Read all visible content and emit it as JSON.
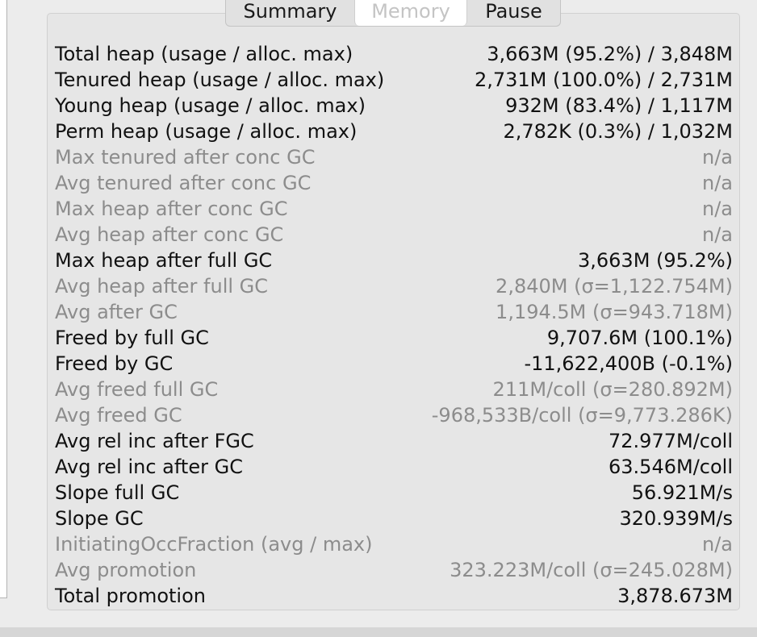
{
  "tabs": [
    {
      "label": "Summary"
    },
    {
      "label": "Memory"
    },
    {
      "label": "Pause"
    }
  ],
  "rows": [
    {
      "label": "Total heap (usage / alloc. max)",
      "value": "3,663M (95.2%) / 3,848M",
      "dim": false
    },
    {
      "label": "Tenured heap (usage / alloc. max)",
      "value": "2,731M (100.0%) / 2,731M",
      "dim": false
    },
    {
      "label": "Young heap (usage / alloc. max)",
      "value": "932M (83.4%) / 1,117M",
      "dim": false
    },
    {
      "label": "Perm heap (usage / alloc. max)",
      "value": "2,782K (0.3%) / 1,032M",
      "dim": false
    },
    {
      "label": "Max tenured after conc GC",
      "value": "n/a",
      "dim": true
    },
    {
      "label": "Avg tenured after conc GC",
      "value": "n/a",
      "dim": true
    },
    {
      "label": "Max heap after conc GC",
      "value": "n/a",
      "dim": true
    },
    {
      "label": "Avg heap after conc GC",
      "value": "n/a",
      "dim": true
    },
    {
      "label": "Max heap after full GC",
      "value": "3,663M (95.2%)",
      "dim": false
    },
    {
      "label": "Avg heap after full GC",
      "value": "2,840M (σ=1,122.754M)",
      "dim": true
    },
    {
      "label": "Avg after GC",
      "value": "1,194.5M (σ=943.718M)",
      "dim": true
    },
    {
      "label": "Freed by full GC",
      "value": "9,707.6M (100.1%)",
      "dim": false
    },
    {
      "label": "Freed by GC",
      "value": "-11,622,400B (-0.1%)",
      "dim": false
    },
    {
      "label": "Avg freed full GC",
      "value": "211M/coll (σ=280.892M)",
      "dim": true
    },
    {
      "label": "Avg freed GC",
      "value": "-968,533B/coll (σ=9,773.286K)",
      "dim": true
    },
    {
      "label": "Avg rel inc after FGC",
      "value": "72.977M/coll",
      "dim": false
    },
    {
      "label": "Avg rel inc after GC",
      "value": "63.546M/coll",
      "dim": false
    },
    {
      "label": "Slope full GC",
      "value": "56.921M/s",
      "dim": false
    },
    {
      "label": "Slope GC",
      "value": "320.939M/s",
      "dim": false
    },
    {
      "label": "InitiatingOccFraction (avg / max)",
      "value": "n/a",
      "dim": true
    },
    {
      "label": "Avg promotion",
      "value": "323.223M/coll (σ=245.028M)",
      "dim": true
    },
    {
      "label": "Total promotion",
      "value": "3,878.673M",
      "dim": false
    }
  ]
}
